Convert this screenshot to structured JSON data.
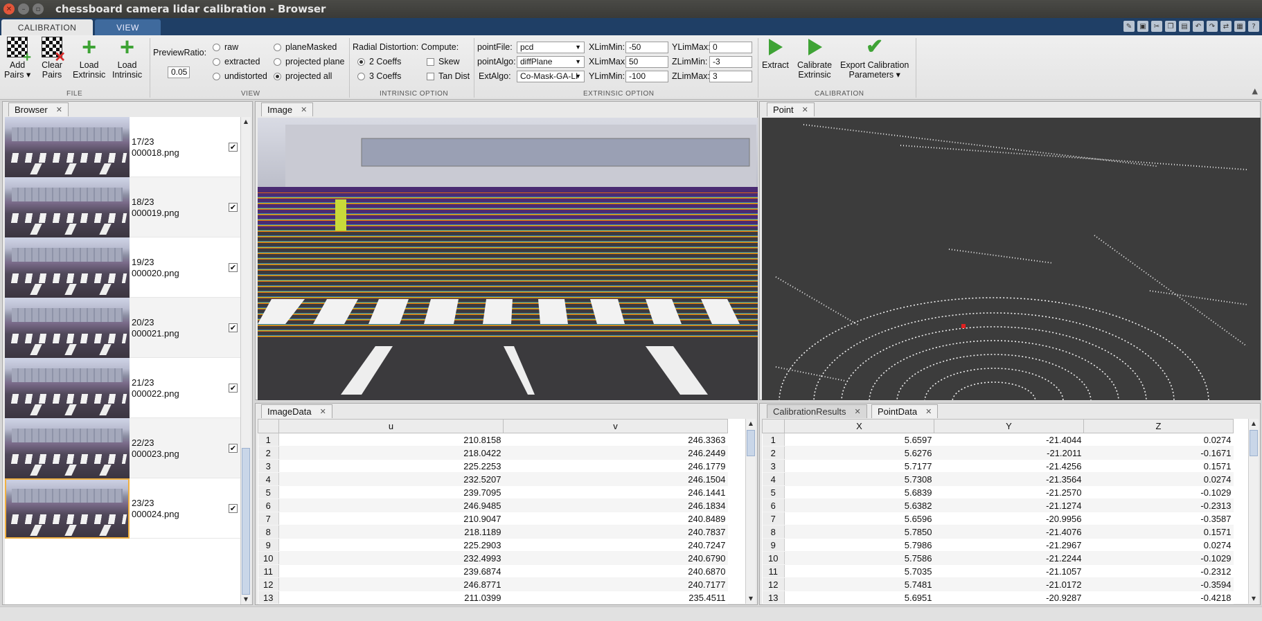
{
  "window": {
    "title": "chessboard camera lidar calibration - Browser"
  },
  "tabs": {
    "calibration": "CALIBRATION",
    "view": "VIEW"
  },
  "ribbon": {
    "file": {
      "section": "FILE",
      "add_pairs": [
        "Add",
        "Pairs ▾"
      ],
      "clear_pairs": [
        "Clear",
        "Pairs"
      ],
      "load_extrinsic": [
        "Load",
        "Extrinsic"
      ],
      "load_intrinsic": [
        "Load",
        "Intrinsic"
      ]
    },
    "view": {
      "section": "VIEW",
      "preview_ratio_label": "PreviewRatio:",
      "preview_ratio_value": "0.05",
      "radios_col1": [
        "raw",
        "extracted",
        "undistorted"
      ],
      "radios_col2": [
        "planeMasked",
        "projected plane",
        "projected all"
      ],
      "selected": "projected all"
    },
    "intrinsic": {
      "section": "INTRINSIC OPTION",
      "radial_label": "Radial Distortion:",
      "compute_label": "Compute:",
      "coeffs": [
        "2 Coeffs",
        "3 Coeffs"
      ],
      "selected_coeffs": "2 Coeffs",
      "checks": [
        "Skew",
        "Tan Dist"
      ]
    },
    "extrinsic": {
      "section": "EXTRINSIC OPTION",
      "point_file_label": "pointFile:",
      "point_file_value": "pcd",
      "point_algo_label": "pointAlgo:",
      "point_algo_value": "diffPlane",
      "ext_algo_label": "ExtAlgo:",
      "ext_algo_value": "Co-Mask-GA-LI",
      "xlimmin_label": "XLimMin:",
      "xlimmin": "-50",
      "xlimmax_label": "XLimMax:",
      "xlimmax": "50",
      "ylimmin_label": "YLimMin:",
      "ylimmin": "-100",
      "ylimmax_label": "YLimMax:",
      "ylimmax": "0",
      "zlimmin_label": "ZLimMin:",
      "zlimmin": "-3",
      "zlimmax_label": "ZLimMax:",
      "zlimmax": "3"
    },
    "calibration": {
      "section": "CALIBRATION",
      "extract": [
        "Extract",
        ""
      ],
      "calibrate": [
        "Calibrate",
        "Extrinsic"
      ],
      "export": [
        "Export Calibration",
        "Parameters ▾"
      ]
    }
  },
  "browser": {
    "tab": "Browser",
    "items": [
      {
        "index": "17/23",
        "file": "000018.png",
        "checked": "✔"
      },
      {
        "index": "18/23",
        "file": "000019.png",
        "checked": "✔"
      },
      {
        "index": "19/23",
        "file": "000020.png",
        "checked": "✔"
      },
      {
        "index": "20/23",
        "file": "000021.png",
        "checked": "✔"
      },
      {
        "index": "21/23",
        "file": "000022.png",
        "checked": "✔"
      },
      {
        "index": "22/23",
        "file": "000023.png",
        "checked": "✔"
      },
      {
        "index": "23/23",
        "file": "000024.png",
        "checked": "✔"
      }
    ]
  },
  "image_panel": {
    "tab": "Image"
  },
  "point_panel": {
    "tab": "Point"
  },
  "image_data": {
    "tab": "ImageData",
    "columns": [
      "u",
      "v"
    ],
    "rows": [
      [
        "1",
        "210.8158",
        "246.3363"
      ],
      [
        "2",
        "218.0422",
        "246.2449"
      ],
      [
        "3",
        "225.2253",
        "246.1779"
      ],
      [
        "4",
        "232.5207",
        "246.1504"
      ],
      [
        "5",
        "239.7095",
        "246.1441"
      ],
      [
        "6",
        "246.9485",
        "246.1834"
      ],
      [
        "7",
        "210.9047",
        "240.8489"
      ],
      [
        "8",
        "218.1189",
        "240.7837"
      ],
      [
        "9",
        "225.2903",
        "240.7247"
      ],
      [
        "10",
        "232.4993",
        "240.6790"
      ],
      [
        "11",
        "239.6874",
        "240.6870"
      ],
      [
        "12",
        "246.8771",
        "240.7177"
      ],
      [
        "13",
        "211.0399",
        "235.4511"
      ]
    ]
  },
  "point_data": {
    "tabs": [
      "CalibrationResults",
      "PointData"
    ],
    "columns": [
      "X",
      "Y",
      "Z"
    ],
    "rows": [
      [
        "1",
        "5.6597",
        "-21.4044",
        "0.0274"
      ],
      [
        "2",
        "5.6276",
        "-21.2011",
        "-0.1671"
      ],
      [
        "3",
        "5.7177",
        "-21.4256",
        "0.1571"
      ],
      [
        "4",
        "5.7308",
        "-21.3564",
        "0.0274"
      ],
      [
        "5",
        "5.6839",
        "-21.2570",
        "-0.1029"
      ],
      [
        "6",
        "5.6382",
        "-21.1274",
        "-0.2313"
      ],
      [
        "7",
        "5.6596",
        "-20.9956",
        "-0.3587"
      ],
      [
        "8",
        "5.7850",
        "-21.4076",
        "0.1571"
      ],
      [
        "9",
        "5.7986",
        "-21.2967",
        "0.0274"
      ],
      [
        "10",
        "5.7586",
        "-21.2244",
        "-0.1029"
      ],
      [
        "11",
        "5.7035",
        "-21.1057",
        "-0.2312"
      ],
      [
        "12",
        "5.7481",
        "-21.0172",
        "-0.3594"
      ],
      [
        "13",
        "5.6951",
        "-20.9287",
        "-0.4218"
      ]
    ]
  },
  "colors": {
    "tabstrip": "#1f3f66",
    "accent_green": "#3ea335",
    "selection_outline": "#f0b040",
    "lidar_highlight": "#e02020"
  }
}
